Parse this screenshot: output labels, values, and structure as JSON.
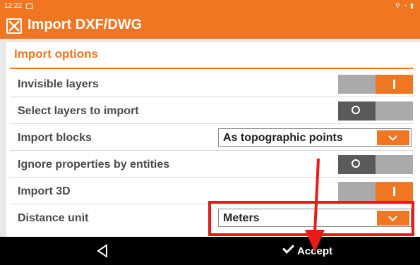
{
  "status_bar": {
    "time": "12:22"
  },
  "app": {
    "title": "Import DXF/DWG"
  },
  "section": {
    "title": "Import options"
  },
  "rows": [
    {
      "label": "Invisible layers",
      "control": "toggle",
      "state": "on"
    },
    {
      "label": "Select layers to import",
      "control": "toggle",
      "state": "off"
    },
    {
      "label": "Import blocks",
      "control": "select",
      "value": "As topographic points"
    },
    {
      "label": "Ignore properties by entities",
      "control": "toggle",
      "state": "off"
    },
    {
      "label": "Import 3D",
      "control": "toggle",
      "state": "on"
    },
    {
      "label": "Distance unit",
      "control": "select",
      "value": "Meters"
    }
  ],
  "nav": {
    "accept_label": "Accept"
  },
  "colors": {
    "accent": "#f07622",
    "annotation": "#ea1a1a"
  },
  "icons": {
    "back": "back-triangle-icon",
    "accept": "check-icon",
    "logo": "app-logo-icon"
  }
}
